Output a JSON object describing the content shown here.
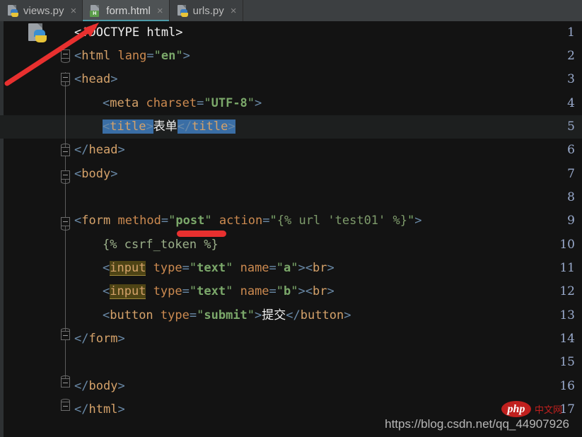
{
  "tabs": [
    {
      "label": "views.py",
      "icon": "python-file-icon",
      "active": false,
      "close": "×"
    },
    {
      "label": "form.html",
      "icon": "html-file-icon",
      "active": true,
      "close": "×",
      "badge": "H"
    },
    {
      "label": "urls.py",
      "icon": "python-file-icon",
      "active": false,
      "close": "×"
    }
  ],
  "editor": {
    "current_line": 5,
    "line_numbers": [
      "1",
      "2",
      "3",
      "4",
      "5",
      "6",
      "7",
      "8",
      "9",
      "10",
      "11",
      "12",
      "13",
      "14",
      "15",
      "16",
      "17"
    ],
    "lines": [
      {
        "n": "1",
        "text": "<!DOCTYPE html>"
      },
      {
        "n": "2",
        "text": "<html lang=\"en\">"
      },
      {
        "n": "3",
        "text": "<head>"
      },
      {
        "n": "4",
        "text": "    <meta charset=\"UTF-8\">"
      },
      {
        "n": "5",
        "text": "    <title>表单</title>"
      },
      {
        "n": "6",
        "text": "</head>"
      },
      {
        "n": "7",
        "text": "<body>"
      },
      {
        "n": "8",
        "text": ""
      },
      {
        "n": "9",
        "text": "<form method=\"post\" action=\"{% url 'test01' %}\">"
      },
      {
        "n": "10",
        "text": "    {% csrf_token %}"
      },
      {
        "n": "11",
        "text": "    <input type=\"text\" name=\"a\"><br>"
      },
      {
        "n": "12",
        "text": "    <input type=\"text\" name=\"b\"><br>"
      },
      {
        "n": "13",
        "text": "    <button type=\"submit\">提交</button>"
      },
      {
        "n": "14",
        "text": "</form>"
      },
      {
        "n": "15",
        "text": ""
      },
      {
        "n": "16",
        "text": "</body>"
      },
      {
        "n": "17",
        "text": "</html>"
      }
    ],
    "tokens": {
      "doctype": "<!DOCTYPE html>",
      "title_open": "<title>",
      "title_text": "表单",
      "title_close": "</title>",
      "form_method_value": "post",
      "form_action_value": "{% url 'test01' %}",
      "csrf_token": "{% csrf_token %}",
      "input_a_name": "a",
      "input_b_name": "b",
      "button_text": "提交",
      "submit_value": "submit",
      "text_value": "text",
      "lang_value": "en",
      "charset_value": "UTF-8"
    }
  },
  "annotations": {
    "arrow_color": "#e8302f",
    "underline_color": "#e8302f",
    "arrow_target": "form.html tab",
    "underline_target": "post"
  },
  "watermark": {
    "url": "https://blog.csdn.net/qq_44907926",
    "logo_text": "php",
    "logo_suffix": "中文网"
  },
  "colors": {
    "background": "#131313",
    "tabbar": "#3c3f41",
    "active_tab": "#4e5254",
    "active_tab_underline": "#4d9ba8",
    "line_number": "#99aacc",
    "tag": "#d5a26a",
    "attr": "#cc8a50",
    "value": "#7ba86a",
    "punct": "#6a8aa8",
    "selection": "#3a6ea5",
    "highlight": "#4e4415",
    "current_line_bg": "#1d1f1f"
  }
}
